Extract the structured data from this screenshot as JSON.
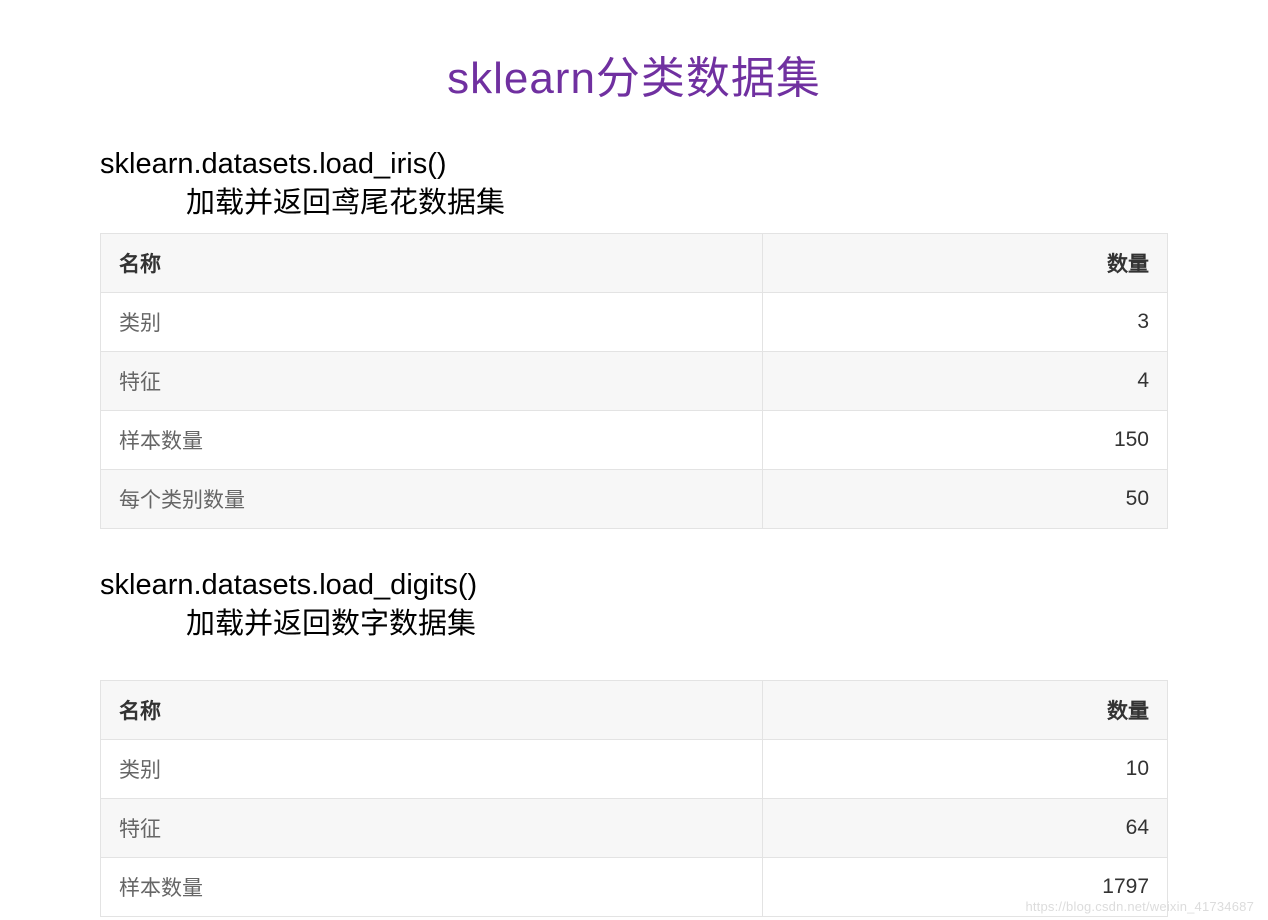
{
  "title": "sklearn分类数据集",
  "sections": [
    {
      "function": "sklearn.datasets.load_iris()",
      "description": "加载并返回鸢尾花数据集",
      "table": {
        "headers": {
          "name": "名称",
          "quantity": "数量"
        },
        "rows": [
          {
            "name": "类别",
            "quantity": "3"
          },
          {
            "name": "特征",
            "quantity": "4"
          },
          {
            "name": "样本数量",
            "quantity": "150"
          },
          {
            "name": "每个类别数量",
            "quantity": "50"
          }
        ]
      }
    },
    {
      "function": "sklearn.datasets.load_digits()",
      "description": "加载并返回数字数据集",
      "table": {
        "headers": {
          "name": "名称",
          "quantity": "数量"
        },
        "rows": [
          {
            "name": "类别",
            "quantity": "10"
          },
          {
            "name": "特征",
            "quantity": "64"
          },
          {
            "name": "样本数量",
            "quantity": "1797"
          }
        ]
      }
    }
  ],
  "watermark": "https://blog.csdn.net/weixin_41734687"
}
